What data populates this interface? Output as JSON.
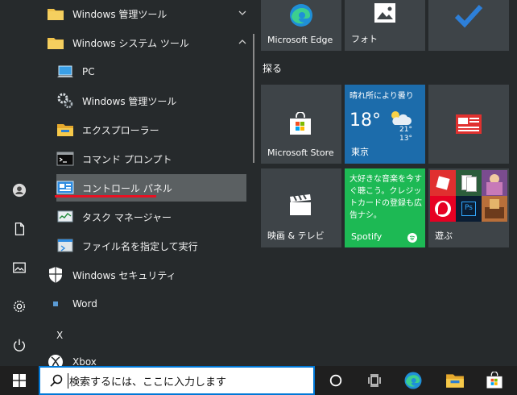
{
  "app_list": {
    "items": [
      {
        "label": "Windows 管理ツール",
        "icon": "folder-icon"
      },
      {
        "label": "Windows システム ツール",
        "icon": "folder-icon"
      },
      {
        "label": "PC",
        "icon": "pc-icon"
      },
      {
        "label": "Windows 管理ツール",
        "icon": "admin-tools-icon"
      },
      {
        "label": "エクスプローラー",
        "icon": "file-explorer-icon"
      },
      {
        "label": "コマンド プロンプト",
        "icon": "command-prompt-icon"
      },
      {
        "label": "コントロール パネル",
        "icon": "control-panel-icon"
      },
      {
        "label": "タスク マネージャー",
        "icon": "task-manager-icon"
      },
      {
        "label": "ファイル名を指定して実行",
        "icon": "run-icon"
      },
      {
        "label": "Windows セキュリティ",
        "icon": "shield-icon"
      },
      {
        "label": "Word",
        "icon": "word-icon"
      },
      {
        "label": "X",
        "icon": ""
      },
      {
        "label": "Xbox",
        "icon": "xbox-icon"
      }
    ],
    "selected_index": 6
  },
  "tiles": {
    "group_title": "探る",
    "edge": {
      "label": "Microsoft Edge",
      "icon": "edge-icon"
    },
    "photos": {
      "label": "フォト",
      "icon": "photos-icon"
    },
    "todo": {
      "icon": "checkmark-icon"
    },
    "store": {
      "label": "Microsoft Store",
      "icon": "store-icon"
    },
    "weather": {
      "condition": "晴れ所により曇り",
      "temp": "18°",
      "high": "21°",
      "low": "13°",
      "location": "東京"
    },
    "news": {
      "icon": "news-icon"
    },
    "movies": {
      "label": "映画 & テレビ",
      "icon": "clapperboard-icon"
    },
    "spotify": {
      "label": "Spotify",
      "text": "大好きな音楽を今すぐ聴こう。クレジットカードの登録も広告ナシ。"
    },
    "play": {
      "label": "遊ぶ"
    }
  },
  "taskbar": {
    "search_placeholder": "検索するには、ここに入力します",
    "colors": {
      "accent": "#0078d7",
      "spotify": "#1db954",
      "underline": "#e81123"
    }
  }
}
